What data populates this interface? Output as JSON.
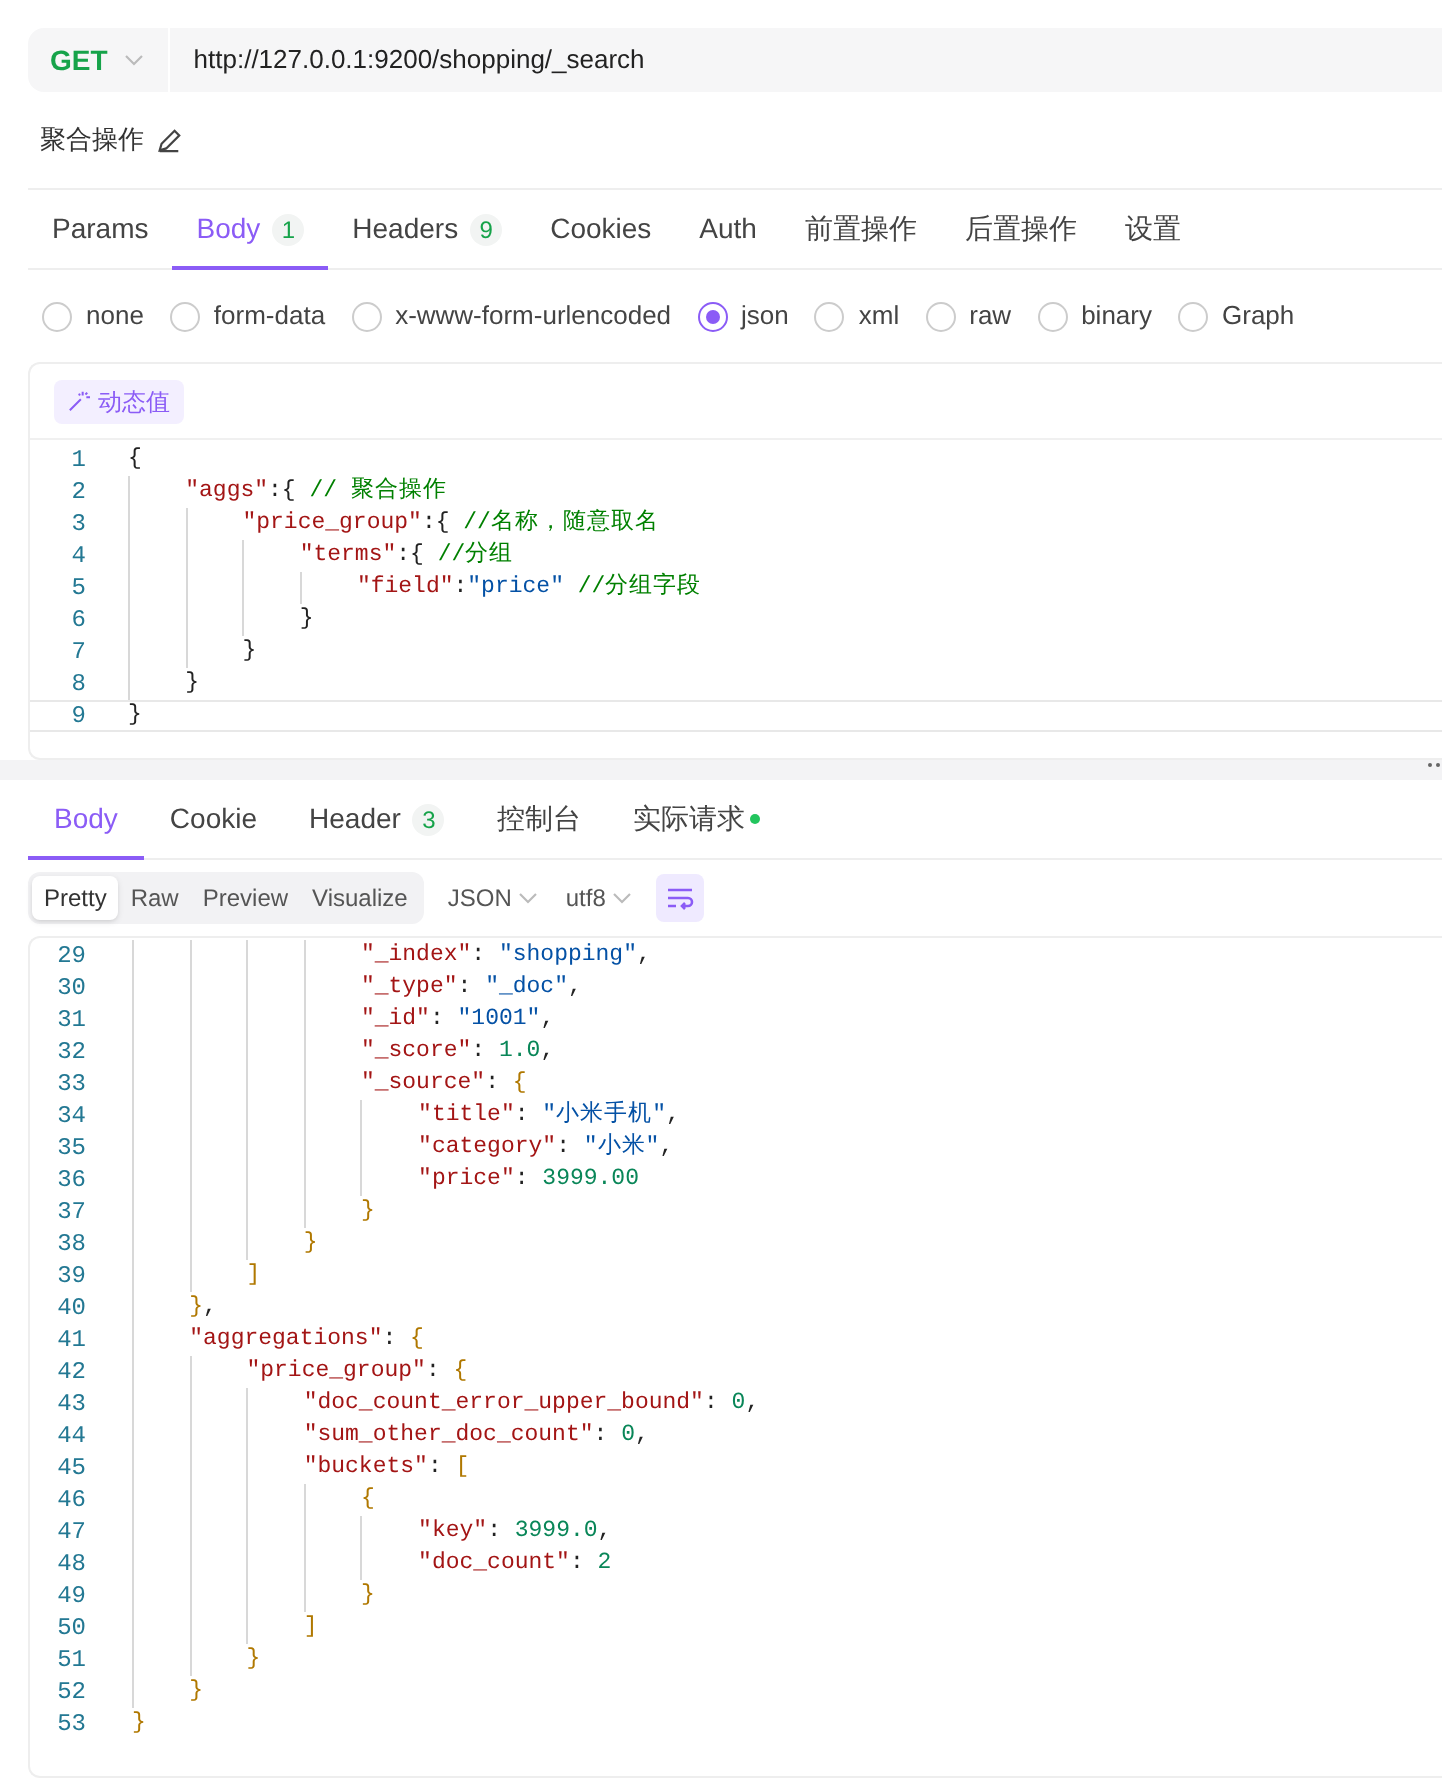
{
  "request": {
    "method": "GET",
    "url": "http://127.0.0.1:9200/shopping/_search",
    "name": "聚合操作"
  },
  "request_tabs": [
    {
      "label": "Params",
      "selected": false
    },
    {
      "label": "Body",
      "badge": "1",
      "selected": true
    },
    {
      "label": "Headers",
      "badge": "9",
      "selected": false
    },
    {
      "label": "Cookies",
      "selected": false
    },
    {
      "label": "Auth",
      "selected": false
    },
    {
      "label": "前置操作",
      "selected": false
    },
    {
      "label": "后置操作",
      "selected": false
    },
    {
      "label": "设置",
      "selected": false
    }
  ],
  "body_types": [
    {
      "label": "none",
      "selected": false
    },
    {
      "label": "form-data",
      "selected": false
    },
    {
      "label": "x-www-form-urlencoded",
      "selected": false
    },
    {
      "label": "json",
      "selected": true
    },
    {
      "label": "xml",
      "selected": false
    },
    {
      "label": "raw",
      "selected": false
    },
    {
      "label": "binary",
      "selected": false
    },
    {
      "label": "Graph",
      "selected": false
    }
  ],
  "editor": {
    "dynamic_value_button": "动态值",
    "lines": [
      {
        "n": "1",
        "tokens": [
          {
            "kind": "punct",
            "text": "{"
          }
        ]
      },
      {
        "n": "2",
        "tokens": [
          {
            "kind": "key",
            "text": "    \"aggs\""
          },
          {
            "kind": "punct",
            "text": ":{ "
          },
          {
            "kind": "comment",
            "text": "// 聚合操作"
          }
        ]
      },
      {
        "n": "3",
        "tokens": [
          {
            "kind": "key",
            "text": "        \"price_group\""
          },
          {
            "kind": "punct",
            "text": ":{ "
          },
          {
            "kind": "comment",
            "text": "//名称，随意取名"
          }
        ]
      },
      {
        "n": "4",
        "tokens": [
          {
            "kind": "key",
            "text": "            \"terms\""
          },
          {
            "kind": "punct",
            "text": ":{ "
          },
          {
            "kind": "comment",
            "text": "//分组"
          }
        ]
      },
      {
        "n": "5",
        "tokens": [
          {
            "kind": "key",
            "text": "                \"field\""
          },
          {
            "kind": "punct",
            "text": ":"
          },
          {
            "kind": "string",
            "text": "\"price\" "
          },
          {
            "kind": "comment",
            "text": "//分组字段"
          }
        ]
      },
      {
        "n": "6",
        "tokens": [
          {
            "kind": "punct",
            "text": "            }"
          }
        ]
      },
      {
        "n": "7",
        "tokens": [
          {
            "kind": "punct",
            "text": "        }"
          }
        ]
      },
      {
        "n": "8",
        "tokens": [
          {
            "kind": "punct",
            "text": "    }"
          }
        ]
      },
      {
        "n": "9",
        "selected": true,
        "tokens": [
          {
            "kind": "punct",
            "text": "}"
          }
        ]
      }
    ]
  },
  "response_tabs": [
    {
      "label": "Body",
      "selected": true
    },
    {
      "label": "Cookie",
      "selected": false
    },
    {
      "label": "Header",
      "badge": "3",
      "selected": false
    },
    {
      "label": "控制台",
      "selected": false
    },
    {
      "label": "实际请求",
      "color": "#22c55e",
      "selected": false
    }
  ],
  "view_modes": [
    {
      "label": "Pretty",
      "selected": true
    },
    {
      "label": "Raw",
      "selected": false
    },
    {
      "label": "Preview",
      "selected": false
    },
    {
      "label": "Visualize",
      "selected": false
    }
  ],
  "dropdowns": [
    "JSON",
    "utf8"
  ],
  "wrap_lines": {
    "on": true
  },
  "response": {
    "lines": [
      {
        "n": "29",
        "tokens": [
          {
            "kind": "key",
            "text": "                \"_index\""
          },
          {
            "kind": "punct",
            "text": ": "
          },
          {
            "kind": "string",
            "text": "\"shopping\""
          },
          {
            "kind": "punct",
            "text": ","
          }
        ]
      },
      {
        "n": "30",
        "tokens": [
          {
            "kind": "key",
            "text": "                \"_type\""
          },
          {
            "kind": "punct",
            "text": ": "
          },
          {
            "kind": "string",
            "text": "\"_doc\""
          },
          {
            "kind": "punct",
            "text": ","
          }
        ]
      },
      {
        "n": "31",
        "tokens": [
          {
            "kind": "key",
            "text": "                \"_id\""
          },
          {
            "kind": "punct",
            "text": ": "
          },
          {
            "kind": "string",
            "text": "\"1001\""
          },
          {
            "kind": "punct",
            "text": ","
          }
        ]
      },
      {
        "n": "32",
        "tokens": [
          {
            "kind": "key",
            "text": "                \"_score\""
          },
          {
            "kind": "punct",
            "text": ": "
          },
          {
            "kind": "number",
            "text": "1.0"
          },
          {
            "kind": "punct",
            "text": ","
          }
        ]
      },
      {
        "n": "33",
        "tokens": [
          {
            "kind": "key",
            "text": "                \"_source\""
          },
          {
            "kind": "punct",
            "text": ": "
          },
          {
            "kind": "bracket",
            "text": "{"
          }
        ]
      },
      {
        "n": "34",
        "tokens": [
          {
            "kind": "key",
            "text": "                    \"title\""
          },
          {
            "kind": "punct",
            "text": ": "
          },
          {
            "kind": "string",
            "text": "\"小米手机\""
          },
          {
            "kind": "punct",
            "text": ","
          }
        ]
      },
      {
        "n": "35",
        "tokens": [
          {
            "kind": "key",
            "text": "                    \"category\""
          },
          {
            "kind": "punct",
            "text": ": "
          },
          {
            "kind": "string",
            "text": "\"小米\""
          },
          {
            "kind": "punct",
            "text": ","
          }
        ]
      },
      {
        "n": "36",
        "tokens": [
          {
            "kind": "key",
            "text": "                    \"price\""
          },
          {
            "kind": "punct",
            "text": ": "
          },
          {
            "kind": "number",
            "text": "3999.00"
          }
        ]
      },
      {
        "n": "37",
        "tokens": [
          {
            "kind": "bracket",
            "text": "                }"
          }
        ]
      },
      {
        "n": "38",
        "tokens": [
          {
            "kind": "bracket",
            "text": "            }"
          }
        ]
      },
      {
        "n": "39",
        "tokens": [
          {
            "kind": "bracket",
            "text": "        ]"
          }
        ]
      },
      {
        "n": "40",
        "tokens": [
          {
            "kind": "bracket",
            "text": "    }"
          },
          {
            "kind": "punct",
            "text": ","
          }
        ]
      },
      {
        "n": "41",
        "tokens": [
          {
            "kind": "key",
            "text": "    \"aggregations\""
          },
          {
            "kind": "punct",
            "text": ": "
          },
          {
            "kind": "bracket",
            "text": "{"
          }
        ]
      },
      {
        "n": "42",
        "tokens": [
          {
            "kind": "key",
            "text": "        \"price_group\""
          },
          {
            "kind": "punct",
            "text": ": "
          },
          {
            "kind": "bracket",
            "text": "{"
          }
        ]
      },
      {
        "n": "43",
        "tokens": [
          {
            "kind": "key",
            "text": "            \"doc_count_error_upper_bound\""
          },
          {
            "kind": "punct",
            "text": ": "
          },
          {
            "kind": "number",
            "text": "0"
          },
          {
            "kind": "punct",
            "text": ","
          }
        ]
      },
      {
        "n": "44",
        "tokens": [
          {
            "kind": "key",
            "text": "            \"sum_other_doc_count\""
          },
          {
            "kind": "punct",
            "text": ": "
          },
          {
            "kind": "number",
            "text": "0"
          },
          {
            "kind": "punct",
            "text": ","
          }
        ]
      },
      {
        "n": "45",
        "tokens": [
          {
            "kind": "key",
            "text": "            \"buckets\""
          },
          {
            "kind": "punct",
            "text": ": "
          },
          {
            "kind": "bracket",
            "text": "["
          }
        ]
      },
      {
        "n": "46",
        "tokens": [
          {
            "kind": "bracket",
            "text": "                {"
          }
        ]
      },
      {
        "n": "47",
        "tokens": [
          {
            "kind": "key",
            "text": "                    \"key\""
          },
          {
            "kind": "punct",
            "text": ": "
          },
          {
            "kind": "number",
            "text": "3999.0"
          },
          {
            "kind": "punct",
            "text": ","
          }
        ]
      },
      {
        "n": "48",
        "tokens": [
          {
            "kind": "key",
            "text": "                    \"doc_count\""
          },
          {
            "kind": "punct",
            "text": ": "
          },
          {
            "kind": "number",
            "text": "2"
          }
        ]
      },
      {
        "n": "49",
        "tokens": [
          {
            "kind": "bracket",
            "text": "                }"
          }
        ]
      },
      {
        "n": "50",
        "tokens": [
          {
            "kind": "bracket",
            "text": "            ]"
          }
        ]
      },
      {
        "n": "51",
        "tokens": [
          {
            "kind": "bracket",
            "text": "        }"
          }
        ]
      },
      {
        "n": "52",
        "tokens": [
          {
            "kind": "bracket",
            "text": "    }"
          }
        ]
      },
      {
        "n": "53",
        "tokens": [
          {
            "kind": "bracket",
            "text": "}"
          }
        ]
      }
    ]
  }
}
